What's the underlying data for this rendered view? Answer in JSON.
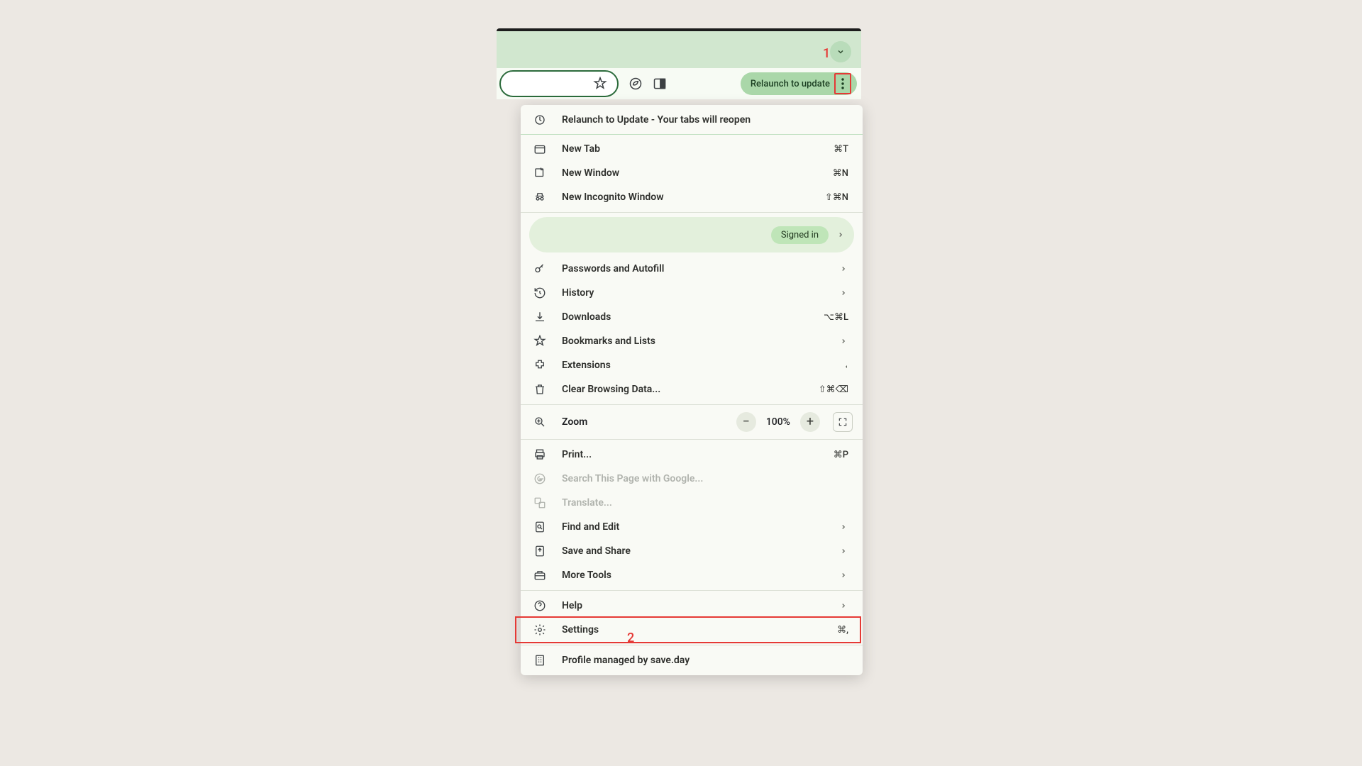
{
  "annotations": {
    "a1": "1",
    "a2": "2"
  },
  "toolbar": {
    "relaunch_chip": "Relaunch to update"
  },
  "menu": {
    "relaunch": "Relaunch to Update - Your tabs will reopen",
    "new_tab": {
      "label": "New Tab",
      "shortcut": "⌘T"
    },
    "new_window": {
      "label": "New Window",
      "shortcut": "⌘N"
    },
    "incognito": {
      "label": "New Incognito Window",
      "shortcut": "⇧⌘N"
    },
    "signed_in": "Signed in",
    "passwords": {
      "label": "Passwords and Autofill"
    },
    "history": {
      "label": "History"
    },
    "downloads": {
      "label": "Downloads",
      "shortcut": "⌥⌘L"
    },
    "bookmarks": {
      "label": "Bookmarks and Lists"
    },
    "extensions": {
      "label": "Extensions"
    },
    "clear": {
      "label": "Clear Browsing Data...",
      "shortcut": "⇧⌘⌫"
    },
    "zoom": {
      "label": "Zoom",
      "value": "100%"
    },
    "print": {
      "label": "Print...",
      "shortcut": "⌘P"
    },
    "search": {
      "label": "Search This Page with Google..."
    },
    "translate": {
      "label": "Translate..."
    },
    "find": {
      "label": "Find and Edit"
    },
    "save": {
      "label": "Save and Share"
    },
    "more_tools": {
      "label": "More Tools"
    },
    "help": {
      "label": "Help"
    },
    "settings": {
      "label": "Settings",
      "shortcut": "⌘,"
    },
    "managed": {
      "label": "Profile managed by save.day"
    }
  }
}
